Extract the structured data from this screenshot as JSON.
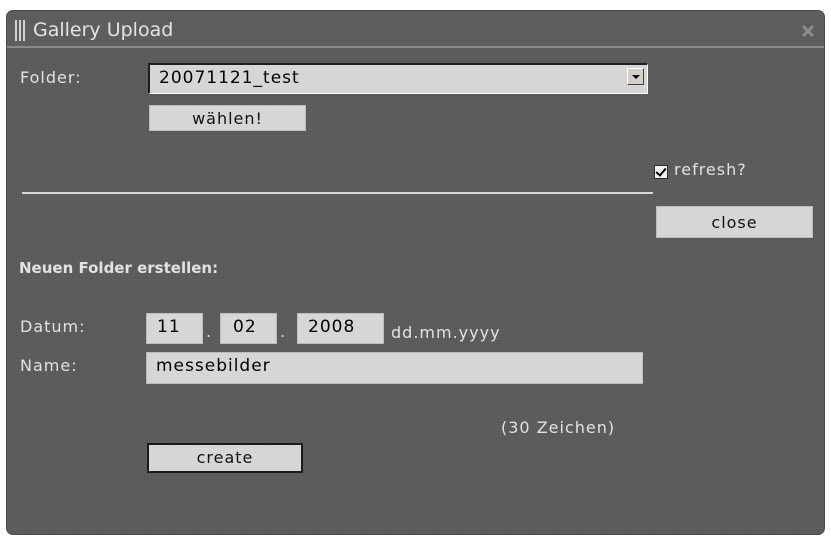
{
  "window": {
    "title": "Gallery Upload",
    "close_icon": "close-x-icon"
  },
  "folder": {
    "label": "Folder:",
    "selected": "20071121_test",
    "choose_label": "wählen!"
  },
  "refresh": {
    "label": "refresh?",
    "checked": true
  },
  "close_label": "close",
  "create_section": {
    "heading": "Neuen Folder erstellen:",
    "date_label": "Datum:",
    "day": "11",
    "month": "02",
    "year": "2008",
    "separator": ".",
    "date_format": "dd.mm.yyyy",
    "name_label": "Name:",
    "name_value": "messebilder",
    "char_hint": "(30 Zeichen)",
    "create_label": "create"
  }
}
